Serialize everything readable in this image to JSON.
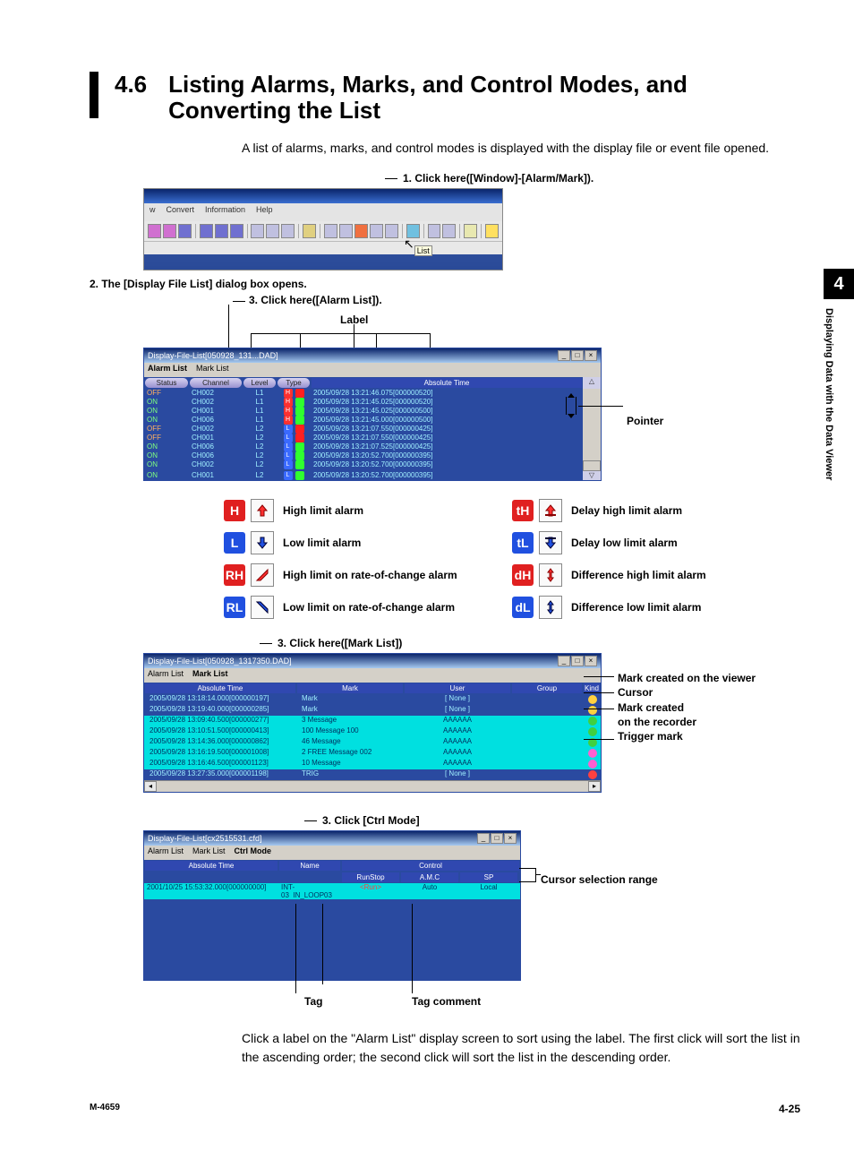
{
  "section": {
    "number": "4.6",
    "title": "Listing Alarms, Marks, and Control Modes, and Converting the List"
  },
  "intro": "A list of alarms, marks, and control modes is displayed with the display file or event file opened.",
  "side": {
    "chapter": "4",
    "label": "Displaying Data with the Data Viewer"
  },
  "step1": "1. Click here([Window]-[Alarm/Mark]).",
  "toolbar": {
    "menus": [
      "w",
      "Convert",
      "Information",
      "Help"
    ],
    "tooltip": "List"
  },
  "step2": "2. The [Display File List] dialog box opens.",
  "step3a": "3. Click here([Alarm List]).",
  "labelWord": "Label",
  "pointerWord": "Pointer",
  "alarmWin": {
    "title": "Display-File-List[050928_131...DAD]",
    "tabs": [
      "Alarm List",
      "Mark List"
    ],
    "headers": [
      "Status",
      "Channel",
      "Level",
      "Type",
      "Absolute Time"
    ],
    "rows": [
      {
        "status": "OFF",
        "chan": "CH002",
        "lvl": "L1",
        "type": "H",
        "time": "2005/09/28 13:21:46.075[000000520]"
      },
      {
        "status": "ON",
        "chan": "CH002",
        "lvl": "L1",
        "type": "H",
        "time": "2005/09/28 13:21:45.025[000000520]"
      },
      {
        "status": "ON",
        "chan": "CH001",
        "lvl": "L1",
        "type": "H",
        "time": "2005/09/28 13:21:45.025[000000500]"
      },
      {
        "status": "ON",
        "chan": "CH006",
        "lvl": "L1",
        "type": "H",
        "time": "2005/09/28 13:21:45.000[000000500]"
      },
      {
        "status": "OFF",
        "chan": "CH002",
        "lvl": "L2",
        "type": "L",
        "time": "2005/09/28 13:21:07.550[000000425]"
      },
      {
        "status": "OFF",
        "chan": "CH001",
        "lvl": "L2",
        "type": "L",
        "time": "2005/09/28 13:21:07.550[000000425]"
      },
      {
        "status": "ON",
        "chan": "CH006",
        "lvl": "L2",
        "type": "L",
        "time": "2005/09/28 13:21:07.525[000000425]"
      },
      {
        "status": "ON",
        "chan": "CH006",
        "lvl": "L2",
        "type": "L",
        "time": "2005/09/28 13:20:52.700[000000395]"
      },
      {
        "status": "ON",
        "chan": "CH002",
        "lvl": "L2",
        "type": "L",
        "time": "2005/09/28 13:20:52.700[000000395]"
      },
      {
        "status": "ON",
        "chan": "CH001",
        "lvl": "L2",
        "type": "L",
        "time": "2005/09/28 13:20:52.700[000000395]"
      }
    ]
  },
  "legend": {
    "H": {
      "abbr": "H",
      "text": "High limit alarm"
    },
    "L": {
      "abbr": "L",
      "text": "Low limit alarm"
    },
    "RH": {
      "abbr": "RH",
      "text": "High limit on rate-of-change alarm"
    },
    "RL": {
      "abbr": "RL",
      "text": "Low limit on rate-of-change alarm"
    },
    "tH": {
      "abbr": "tH",
      "text": "Delay high limit alarm"
    },
    "tL": {
      "abbr": "tL",
      "text": "Delay low limit alarm"
    },
    "dH": {
      "abbr": "dH",
      "text": "Difference high limit alarm"
    },
    "dL": {
      "abbr": "dL",
      "text": "Difference low limit alarm"
    }
  },
  "step3b": "3. Click here([Mark List])",
  "markWin": {
    "title": "Display-File-List[050928_1317350.DAD]",
    "tabs": [
      "Alarm List",
      "Mark List"
    ],
    "headers": [
      "Absolute Time",
      "Mark",
      "User",
      "Group",
      "Kind"
    ],
    "rows": [
      {
        "hl": false,
        "time": "2005/09/28 13:18:14.000[000000197]",
        "mark": "Mark",
        "user": "[ None ]",
        "group": "",
        "kind": "y"
      },
      {
        "hl": false,
        "time": "2005/09/28 13:19:40.000[000000285]",
        "mark": "Mark",
        "user": "[ None ]",
        "group": "",
        "kind": "y"
      },
      {
        "hl": true,
        "time": "2005/09/28 13:09:40.500[000000277]",
        "mark": "3 Message",
        "user": "AAAAAA",
        "group": "",
        "kind": "g"
      },
      {
        "hl": true,
        "time": "2005/09/28 13:10:51.500[000000413]",
        "mark": "100 Message 100",
        "user": "AAAAAA",
        "group": "",
        "kind": "g"
      },
      {
        "hl": true,
        "time": "2005/09/28 13:14:36.000[000000862]",
        "mark": "46 Message",
        "user": "AAAAAA",
        "group": "",
        "kind": "g"
      },
      {
        "hl": true,
        "time": "2005/09/28 13:16:19.500[000001008]",
        "mark": "2 FREE Message 002",
        "user": "AAAAAA",
        "group": "",
        "kind": "p"
      },
      {
        "hl": true,
        "time": "2005/09/28 13:16:46.500[000001123]",
        "mark": "10 Message",
        "user": "AAAAAA",
        "group": "",
        "kind": "p"
      },
      {
        "hl": false,
        "time": "2005/09/28 13:27:35.000[000001198]",
        "mark": "TRIG",
        "user": "[ None ]",
        "group": "",
        "kind": "r"
      }
    ]
  },
  "markAnnots": {
    "a": "Mark created on the viewer",
    "b": "Cursor",
    "c": "Mark created",
    "c2": "on the recorder",
    "d": "Trigger mark"
  },
  "step3c": "3. Click [Ctrl Mode]",
  "ctrlWin": {
    "title": "Display-File-List[cx2515531.cfd]",
    "tabs": [
      "Alarm List",
      "Mark List",
      "Ctrl Mode"
    ],
    "headers": {
      "time": "Absolute Time",
      "name": "Name",
      "control": "Control",
      "sub": [
        "RunStop",
        "A.M.C",
        "SP"
      ]
    },
    "row": {
      "time": "2001/10/25 15:53:32.000[000000000]",
      "name": "INT-03",
      "n2": "IN_LOOP03",
      "rs": "<Run>",
      "amc": "Auto",
      "sp": "Local"
    }
  },
  "ctrlAnnots": {
    "cursor": "Cursor selection range",
    "tag": "Tag",
    "tagc": "Tag comment"
  },
  "outro": "Click a label on the \"Alarm List\" display screen to sort using the label.  The first click will sort the list in the ascending order; the second click will sort the list in the descending order.",
  "footer": {
    "left": "M-4659",
    "right": "4-25"
  }
}
